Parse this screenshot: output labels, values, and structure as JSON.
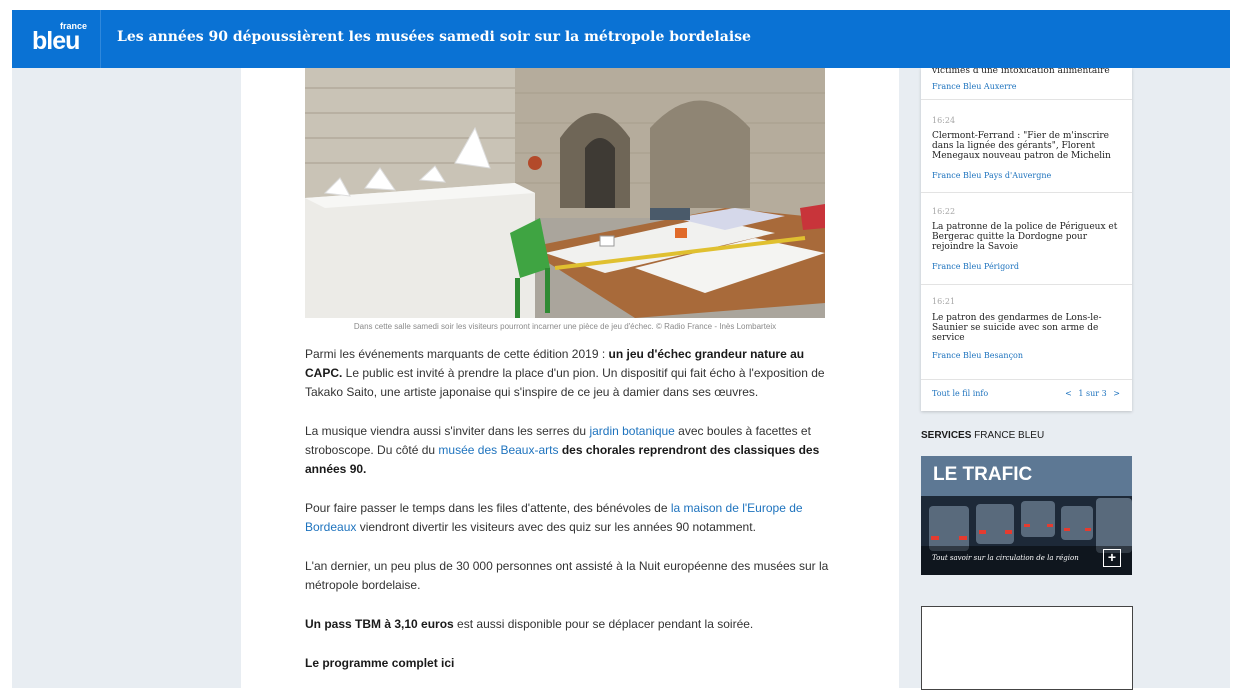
{
  "header": {
    "logo_small": "france",
    "logo_big": "bleu",
    "headline": "Les années 90 dépoussièrent les musées samedi soir sur la métropole bordelaise"
  },
  "article": {
    "caption": "Dans cette salle samedi soir les visiteurs pourront incarner une pièce de jeu d'échec. © Radio France - Inès Lombarteix",
    "para1": {
      "t1": "Parmi les événements marquants de cette édition 2019 : ",
      "b1": "un jeu d'échec grandeur nature ",
      "l1": "au CAPC.",
      "t2": " Le public est invité à prendre la place d'un pion. Un dispositif qui fait écho à l'exposition de Takako Saito, une artiste japonaise qui s'inspire de ce jeu à damier dans ses œuvres."
    },
    "para2": {
      "t1": "La musique viendra aussi s'inviter dans les serres du ",
      "l1": "jardin botanique",
      "t2": " avec boules à facettes et stroboscope. Du côté du ",
      "l2": "musée des Beaux-arts",
      "b1": " des chorales reprendront des classiques des années 90."
    },
    "para3": {
      "t1": "Pour faire passer le temps dans les files d'attente, des bénévoles de ",
      "l1": "la maison de l'Europe de Bordeaux",
      "t2": " viendront divertir les visiteurs avec des quiz sur les années 90 notamment."
    },
    "para4": "L'an dernier, un peu plus de 30 000 personnes ont assisté à la Nuit européenne des musées sur la métropole bordelaise.",
    "para5": {
      "b1": "Un pass TBM à 3,10 euros",
      "t1": " est aussi disponible pour se déplacer pendant la soirée."
    },
    "para6": {
      "b1": "Le programme complet ",
      "l1": "ici"
    }
  },
  "sidebar": {
    "items": [
      {
        "time": "",
        "title": "victimes d'une intoxication alimentaire",
        "source": "France Bleu Auxerre"
      },
      {
        "time": "16:24",
        "title": "Clermont-Ferrand : \"Fier de m'inscrire dans la lignée des gérants\", Florent Menegaux nouveau patron de Michelin",
        "source": "France Bleu Pays d'Auvergne"
      },
      {
        "time": "16:22",
        "title": "La patronne de la police de Périgueux et Bergerac quitte la Dordogne pour rejoindre la Savoie",
        "source": "France Bleu Périgord"
      },
      {
        "time": "16:21",
        "title": "Le patron des gendarmes de Lons-le-Saunier se suicide avec son arme de service",
        "source": "France Bleu Besançon"
      }
    ],
    "all_link": "Tout le fil info",
    "pager_prev": "<",
    "pager_text": "1 sur 3",
    "pager_next": ">"
  },
  "services": {
    "label_bold": "SERVICES",
    "label_rest": " FRANCE BLEU",
    "trafic_title": "LE TRAFIC",
    "trafic_sub": "Tout savoir sur la circulation de la région",
    "trafic_plus": "+"
  },
  "colors": {
    "brand_blue": "#0a72d4",
    "link_blue": "#1e73be",
    "page_bg": "#e8edf2"
  }
}
